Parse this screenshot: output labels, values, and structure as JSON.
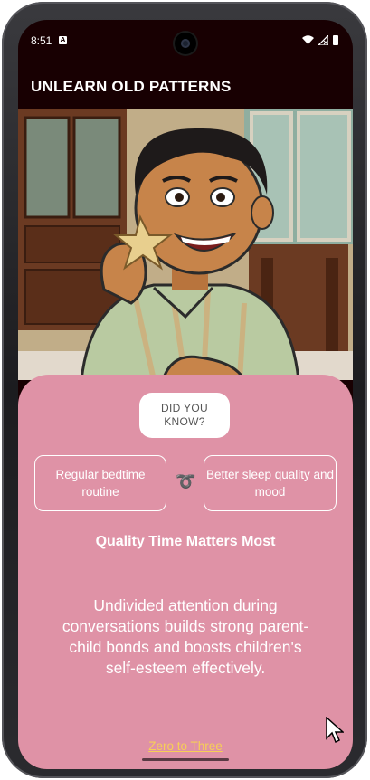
{
  "status_bar": {
    "time": "8:51",
    "notification_icon_letter": "A",
    "icons": [
      "wifi-icon",
      "signal-icon",
      "battery-icon"
    ]
  },
  "app_bar": {
    "title": "UNLEARN OLD PATTERNS"
  },
  "hero_image": {
    "description_icon": "illustration-boy-eating-cookie"
  },
  "card": {
    "badge": "DID YOU KNOW?",
    "before": "Regular bedtime routine",
    "arrow_glyph": "➰",
    "after": "Better sleep quality and mood",
    "heading": "Quality Time Matters Most",
    "body": "Undivided attention during conversations builds strong parent-child bonds and boosts children's self-esteem effectively.",
    "source_link": "Zero to Three"
  },
  "colors": {
    "screen_bg": "#180002",
    "card_bg": "#df92a6",
    "link": "#f6cf56",
    "text": "#ffffff"
  }
}
